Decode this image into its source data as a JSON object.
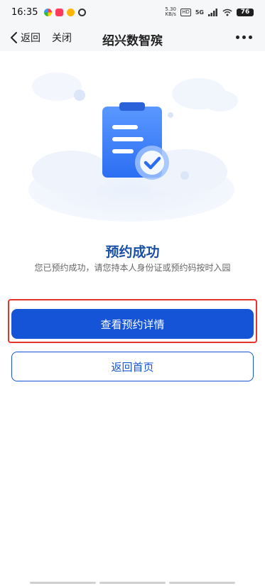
{
  "status_bar": {
    "time": "16:35",
    "net_speed_value": "5.30",
    "net_speed_unit": "KB/s",
    "hd": "HD",
    "signal": "5G",
    "battery": "76"
  },
  "nav": {
    "back_label": "返回",
    "close_label": "关闭",
    "title": "绍兴数智殡"
  },
  "result": {
    "title": "预约成功",
    "description": "您已预约成功，请您持本人身份证或预约码按时入园"
  },
  "buttons": {
    "view_details": "查看预约详情",
    "back_home": "返回首页"
  },
  "colors": {
    "primary": "#1554d6",
    "title_blue": "#1a4fa8",
    "highlight": "#e8342c"
  },
  "icons": [
    "chevron-left-icon",
    "more-icon",
    "clipboard-check-icon"
  ]
}
